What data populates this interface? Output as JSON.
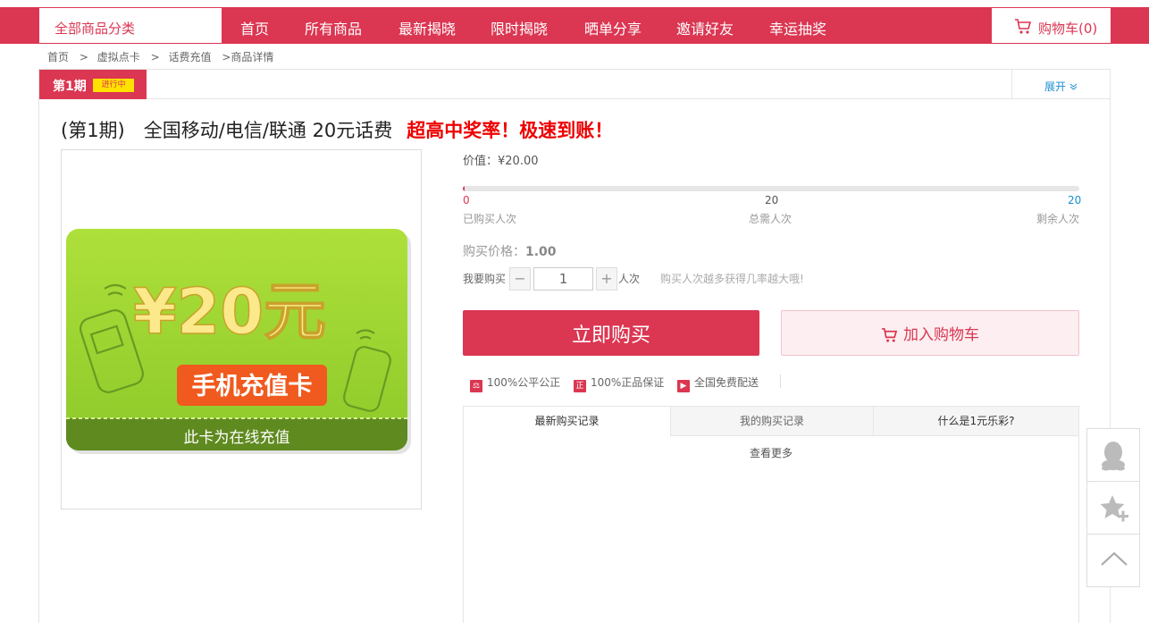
{
  "header": {
    "category_label": "全部商品分类",
    "nav": [
      "首页",
      "所有商品",
      "最新揭晓",
      "限时揭晓",
      "晒单分享",
      "邀请好友",
      "幸运抽奖"
    ],
    "cart_label": "购物车(0)"
  },
  "breadcrumb": [
    "首页",
    ">",
    "虚拟点卡",
    ">",
    "话费充值",
    ">商品详情"
  ],
  "period": {
    "label": "第1期",
    "status": "进行中",
    "expand_label": "展开"
  },
  "product": {
    "title": "(第1期)　全国移动/电信/联通 20元话费",
    "highlight": "超高中奖率！极速到账！",
    "card_amount": "¥20元",
    "card_type": "手机充值卡",
    "card_note": "此卡为在线充值"
  },
  "value_line": "价值：¥20.00",
  "progress": {
    "bought": "0",
    "total": "20",
    "remaining": "20",
    "bought_label": "已购买人次",
    "total_label": "总需人次",
    "remaining_label": "剩余人次",
    "fill_fraction": 0.003
  },
  "purchase": {
    "price_label": "购买价格：",
    "price_value": "1.00",
    "qty_label": "我要购买",
    "qty_value": "1",
    "qty_unit": "人次",
    "qty_tip": "购买人次越多获得几率越大哦!",
    "buy_now": "立即购买",
    "add_cart": "加入购物车"
  },
  "guarantees": [
    "100%公平公正",
    "100%正品保证",
    "全国免费配送"
  ],
  "guarantee_icons": [
    "scale-icon",
    "zheng-icon",
    "truck-icon"
  ],
  "records": {
    "tabs": [
      "最新购买记录",
      "我的购买记录",
      "什么是1元乐彩?"
    ],
    "more": "查看更多"
  },
  "colors": {
    "brand": "#db3652",
    "highlight": "#e00000",
    "link": "#1a8fd0"
  }
}
